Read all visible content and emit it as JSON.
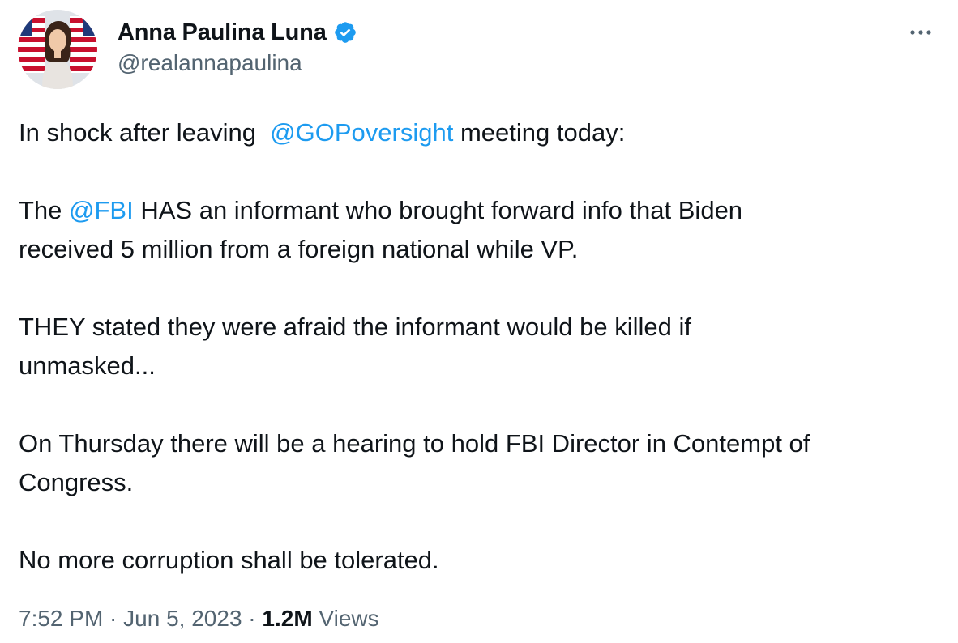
{
  "author": {
    "display_name": "Anna Paulina Luna",
    "handle": "@realannapaulina",
    "verified_icon": "verified-badge-icon",
    "avatar_icon": "profile-photo"
  },
  "menu": {
    "icon": "more-horizontal-icon"
  },
  "tweet": {
    "line1_prefix": "In shock after leaving  ",
    "line1_mention": "@GOPoversight",
    "line1_suffix": " meeting today:",
    "para2_prefix": "The ",
    "para2_mention": "@FBI",
    "para2_line1_suffix": " HAS an informant who brought forward info that Biden",
    "para2_line2": "received 5 million from a foreign national while VP.",
    "para3_line1": "THEY stated they were afraid the informant would be killed if",
    "para3_line2": "unmasked...",
    "para4_line1": "On Thursday there will be a hearing to hold FBI Director in Contempt of",
    "para4_line2": "Congress.",
    "para5": "No more corruption shall be tolerated."
  },
  "meta": {
    "time": "7:52 PM",
    "separator": " · ",
    "date": "Jun 5, 2023",
    "views_count": "1.2M",
    "views_label": " Views"
  },
  "colors": {
    "link": "#1d9bf0",
    "text": "#0f1419",
    "secondary": "#536471"
  }
}
